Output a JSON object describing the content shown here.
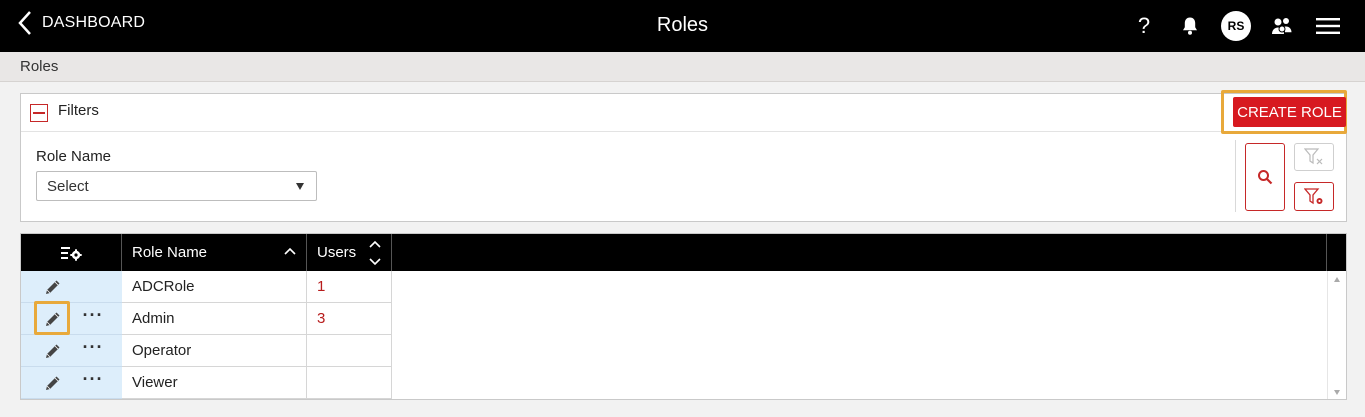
{
  "header": {
    "back_label": "DASHBOARD",
    "title": "Roles",
    "help_label": "?",
    "avatar_initials": "RS"
  },
  "breadcrumb": {
    "label": "Roles"
  },
  "filters": {
    "label": "Filters",
    "create_button": "CREATE ROLE",
    "role_name_label": "Role Name",
    "role_name_select_value": "Select"
  },
  "grid": {
    "columns": {
      "role_name": "Role Name",
      "users": "Users"
    },
    "rows": [
      {
        "role_name": "ADCRole",
        "users": "1",
        "has_more_menu": false
      },
      {
        "role_name": "Admin",
        "users": "3",
        "has_more_menu": true
      },
      {
        "role_name": "Operator",
        "users": "",
        "has_more_menu": true
      },
      {
        "role_name": "Viewer",
        "users": "",
        "has_more_menu": true
      }
    ]
  },
  "colors": {
    "accent_red": "#d71920",
    "highlight_orange": "#e8a93b",
    "header_black": "#000000",
    "action_cell_blue": "#ddeefb"
  },
  "icons": [
    "chevron-left-icon",
    "help-icon",
    "bell-icon",
    "user-group-icon",
    "hamburger-menu-icon",
    "collapse-icon",
    "search-icon",
    "filter-clear-icon",
    "filter-settings-icon",
    "column-settings-icon",
    "sort-asc-icon",
    "sort-toggle-icon",
    "pencil-icon",
    "more-dots-icon"
  ]
}
